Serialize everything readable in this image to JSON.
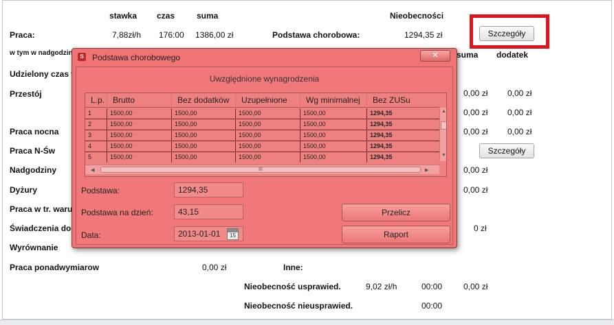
{
  "header": {
    "col_stawka": "stawka",
    "col_czas": "czas",
    "col_suma": "suma",
    "nieobecnosci": "Nieobecności",
    "col_suma2": "suma",
    "col_dodatek": "dodatek"
  },
  "rows": {
    "praca": {
      "label": "Praca:",
      "stawka": "7,88zł/h",
      "czas": "176:00",
      "suma": "1386,00 zł"
    },
    "podstawa_chorobowa": {
      "label": "Podstawa chorobowa:",
      "value": "1294,35 zł"
    },
    "nadgodziny_w_tym": "w tym w nadgodzin",
    "udzielony": "Udzielony czas w",
    "przestoj": "Przestój",
    "praca_nocna": "Praca nocna",
    "praca_nsw": "Praca N-Św",
    "nadgodziny": "Nadgodziny",
    "dyzury": "Dyżury",
    "praca_tr": "Praca w tr. waru",
    "swiadczenia": "Świadczenia doc",
    "wyrownanie": "Wyrównanie",
    "ponadwymiar": {
      "label": "Praca ponadwymiarow",
      "suma": "0,00 zł"
    },
    "inne": "Inne:",
    "nieob_uspr": {
      "label": "Nieobecność usprawied.",
      "stawka": "9,02 zł/h",
      "czas": "00:00",
      "suma": "0,00 zł"
    },
    "nieob_nieuspr": {
      "label": "Nieobecność nieusprawied.",
      "czas": "00:00"
    }
  },
  "right_values": {
    "r1": [
      "0,00 zł",
      "0,00 zł"
    ],
    "r2": [
      "0,00 zł",
      "0,00 zł"
    ],
    "r3": [
      "0,00 zł",
      "0,00 zł"
    ],
    "r4": "0,00 zł",
    "r5": "0,00 zł",
    "r6": "0 zł"
  },
  "buttons": {
    "szczegoly_1": "Szczegóły",
    "szczegoly_2": "Szczegóły"
  },
  "dialog": {
    "title": "Podstawa chorobowego",
    "close": "✕",
    "group_title": "Uwzględnione wynagrodzenia",
    "columns": [
      "L.p.",
      "Brutto",
      "Bez dodatków",
      "Uzupełnione",
      "Wg minimalnej",
      "Bez ZUSu"
    ],
    "rows": [
      [
        "1",
        "1500,00",
        "1500,00",
        "1500,00",
        "1500,00",
        "1294,35"
      ],
      [
        "2",
        "1500,00",
        "1500,00",
        "1500,00",
        "1500,00",
        "1294,35"
      ],
      [
        "3",
        "1500,00",
        "1500,00",
        "1500,00",
        "1500,00",
        "1294,35"
      ],
      [
        "4",
        "1500,00",
        "1500,00",
        "1500,00",
        "1500,00",
        "1294,35"
      ],
      [
        "5",
        "1500,00",
        "1500,00",
        "1500,00",
        "1500,00",
        "1294,35"
      ]
    ],
    "scroll_grip": "III",
    "podstawa_label": "Podstawa:",
    "podstawa_value": "1294,35",
    "podstawa_dzien_label": "Podstawa na dzień:",
    "podstawa_dzien_value": "43,15",
    "data_label": "Data:",
    "data_value": "2013-01-01",
    "calendar_day": "15",
    "przelicz": "Przelicz",
    "raport": "Raport"
  },
  "colors": {
    "dialog_tint": "#f07474",
    "highlight_border": "#e0121a"
  }
}
